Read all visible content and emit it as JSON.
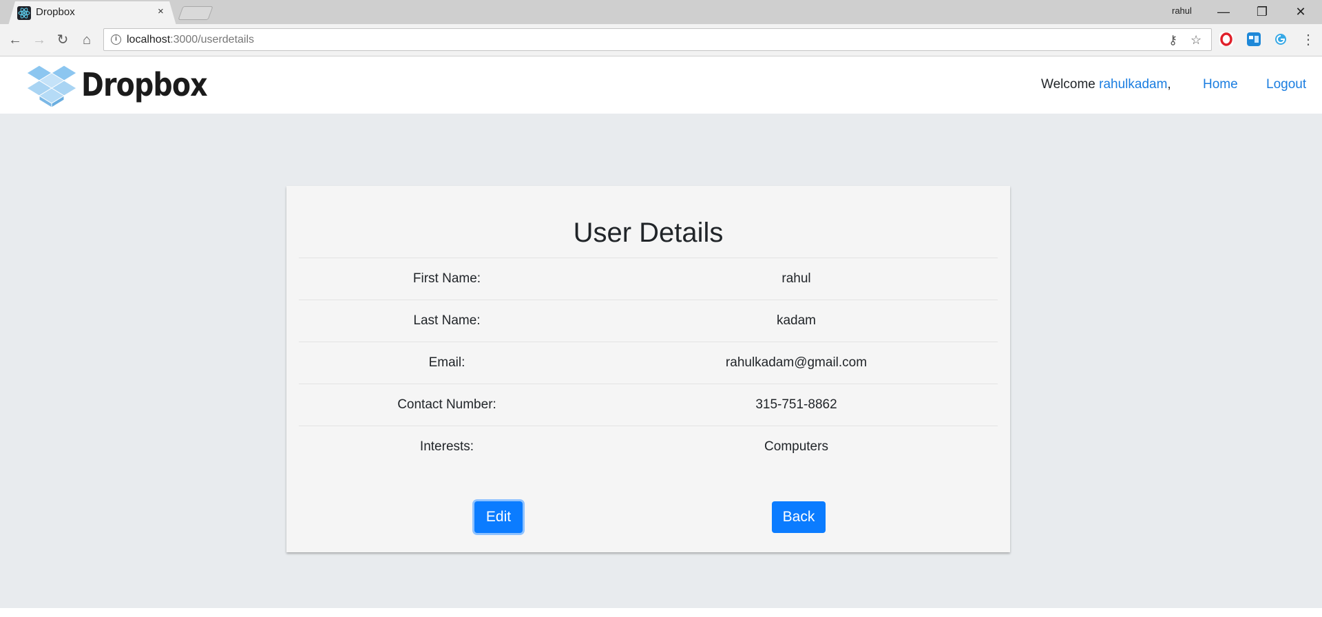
{
  "browser": {
    "tab_title": "Dropbox",
    "tab_close": "×",
    "profile_name": "rahul",
    "window_controls": {
      "minimize": "—",
      "restore": "❐",
      "close": "✕"
    },
    "nav": {
      "back": "←",
      "forward": "→",
      "reload": "↻",
      "home": "⌂"
    },
    "url_host": "localhost",
    "url_rest": ":3000/userdetails",
    "omni_key": "⚷",
    "omni_star": "☆",
    "menu": "⋮"
  },
  "header": {
    "brand": "Dropbox",
    "welcome_text": "Welcome ",
    "username": "rahulkadam",
    "comma": ",",
    "home_link": "Home",
    "logout_link": "Logout"
  },
  "card": {
    "title": "User Details",
    "rows": [
      {
        "label": "First Name:",
        "value": "rahul"
      },
      {
        "label": "Last Name:",
        "value": "kadam"
      },
      {
        "label": "Email:",
        "value": "rahulkadam@gmail.com"
      },
      {
        "label": "Contact Number:",
        "value": "315-751-8862"
      },
      {
        "label": "Interests:",
        "value": "Computers"
      }
    ],
    "edit_button": "Edit",
    "back_button": "Back"
  },
  "colors": {
    "accent": "#0b7cff",
    "link": "#1a7de0",
    "background": "#e8ebee",
    "card": "#f5f5f5"
  }
}
